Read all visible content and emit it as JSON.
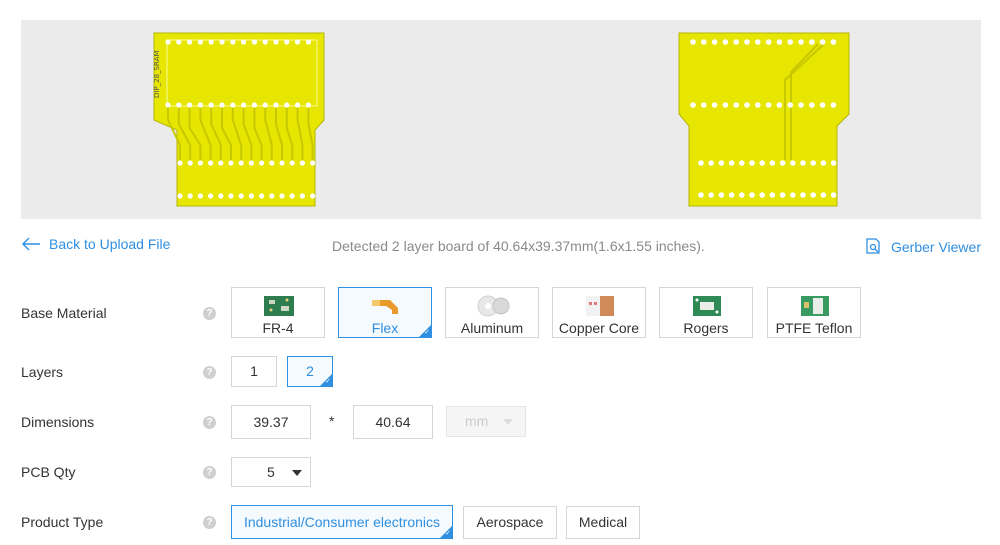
{
  "preview": {
    "top_board_label": "DIP_28_SRAM"
  },
  "infobar": {
    "back_label": "Back to Upload File",
    "detected_text": "Detected 2 layer board of 40.64x39.37mm(1.6x1.55 inches).",
    "gerber_label": "Gerber Viewer"
  },
  "help_glyph": "?",
  "base_material": {
    "label": "Base Material",
    "options": [
      "FR-4",
      "Flex",
      "Aluminum",
      "Copper Core",
      "Rogers",
      "PTFE Teflon"
    ],
    "selected": "Flex"
  },
  "layers": {
    "label": "Layers",
    "options": [
      "1",
      "2"
    ],
    "selected": "2"
  },
  "dimensions": {
    "label": "Dimensions",
    "width": "39.37",
    "separator": "*",
    "height": "40.64",
    "unit": "mm"
  },
  "pcb_qty": {
    "label": "PCB Qty",
    "value": "5"
  },
  "product_type": {
    "label": "Product Type",
    "options": [
      "Industrial/Consumer electronics",
      "Aerospace",
      "Medical"
    ],
    "selected": "Industrial/Consumer electronics"
  },
  "colors": {
    "accent": "#2f8fe0",
    "board": "#e6e600"
  }
}
